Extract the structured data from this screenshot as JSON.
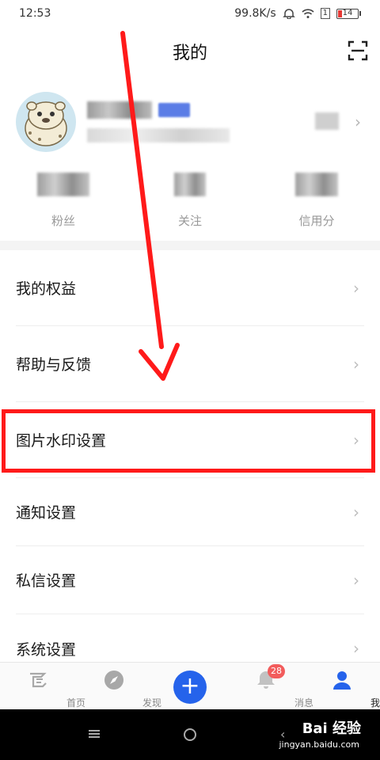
{
  "status_bar": {
    "time": "12:53",
    "net_speed": "99.8K/s",
    "sim": "1",
    "battery": "14"
  },
  "header": {
    "title": "我的"
  },
  "stats": [
    {
      "label": "粉丝"
    },
    {
      "label": "关注"
    },
    {
      "label": "信用分"
    }
  ],
  "menu": [
    {
      "label": "我的权益"
    },
    {
      "label": "帮助与反馈"
    },
    {
      "label": "图片水印设置"
    },
    {
      "label": "通知设置"
    },
    {
      "label": "私信设置"
    },
    {
      "label": "系统设置"
    }
  ],
  "tabbar": {
    "home": "首页",
    "discover": "发现",
    "plus": "+",
    "messages": "消息",
    "messages_badge": "28",
    "mine": "我的"
  },
  "watermark": {
    "brand": "Bai 经验",
    "url": "jingyan.baidu.com"
  },
  "colors": {
    "accent": "#2563eb",
    "annotation": "#ff1a1a",
    "badge": "#f25c5c"
  }
}
